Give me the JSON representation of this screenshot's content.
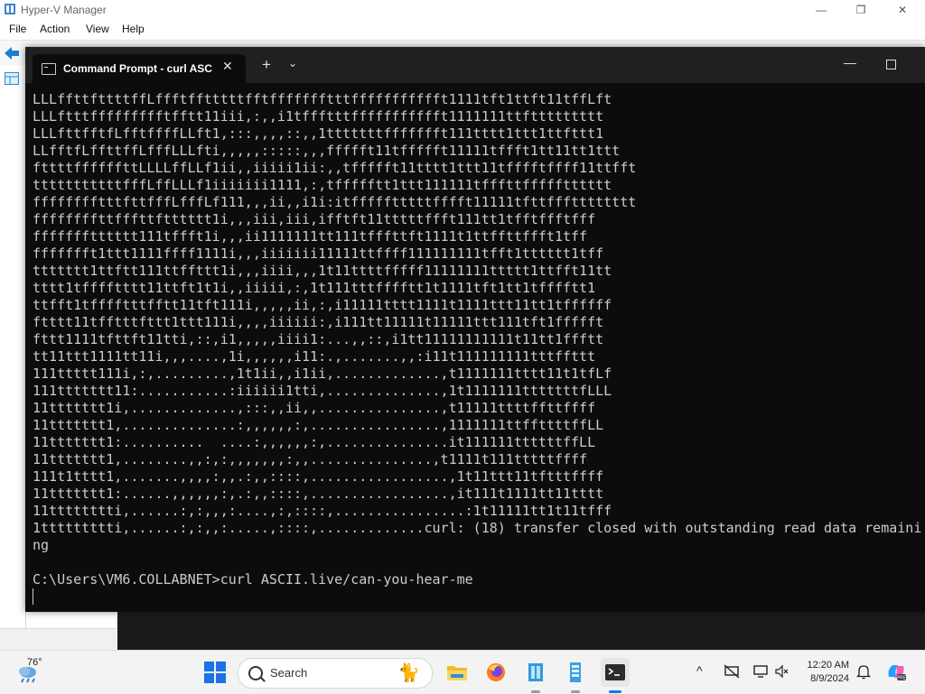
{
  "hyperv": {
    "title": "Hyper-V Manager",
    "menu": [
      "File",
      "Action",
      "View",
      "Help"
    ],
    "controls": {
      "minimize": "—",
      "restore": "❐",
      "close": "✕"
    }
  },
  "terminal": {
    "tab_title": "Command Prompt - curl  ASC",
    "tab_close": "✕",
    "new_tab": "+",
    "dropdown": "⌄",
    "minimize": "—",
    "lines": [
      "LLLffttfttttffLffftfftttttfftffffffftttffffffffffft1111tft1ttft11tffLft",
      "LLLftttffffffffftfftt11iii,:,,i1tffftttffffffffffft1111111ttfttttttttt",
      "LLLfttfftfLfftffffLLft1,:::,,,,::,,1tttttttffffffft111tttt1ttt1ttfttt1",
      "LLfftfLffttffLfffLLLfti,,,,,:::::,,,ffffft11tffffft11111tffft1tt11tt1ttt",
      "fttttffffffttLLLLffLLf1ii,,iiiii1ii:,,tffffft11tttt1ttt11tfffftffff11ttfft",
      "tttttttttttfffLffLLLf1iiiiiii1111,:,tffffftt1ttt111111tfffttffffftttttt",
      "fffffffftttfttfffLfffLf111,,,ii,,i1i:itffffftttttfffft11111tfttffftttttttt",
      "ffffffffttfffttftttttt1i,,,iii,iii,ifftft11tttttffft111tt1tfftffftfff",
      "ffffffftttttt111tffft1i,,,ii1111111tt111tfffttft1111t1ttffttffft1tff",
      "ffffffft1ttt1111ffff1111i,,,iiiiiii11111ttffff111111111tfft1tttttt1tff",
      "ttttttt1ttftt111ttffttt1i,,,iiii,,,1t11ttttfffff11111111ttttt1ttfft11tt",
      "tttt1tfffftttt11ttft1t1i,,iiiii,:,1t111tttfffftt1t1111tft1tt1tfffftt1",
      "ttfft1tfffftttfftt11tft111i,,,,,ii,:,i11111tttt1111t1111ttt11tt1tffffff",
      "ftttt11tfftttfttt1ttt111i,,,,iiiiii:,i111tt11111t11111ttt111tft1ffffft",
      "fttt1111tfttft11tti,::,i1,,,,,iiii1:...,,::,i1tt11111111111t11tt1ffftt",
      "tt11ttt1111tt11i,,,....,1i,,,,,,i11:.,.......,,:i11t111111111tttffttt",
      "111ttttt111i,:,.........,1t1ii,,i1ii,.............,t1111111tttt11t1tfLf",
      "111ttttttt11:...........:iiiiii1tti,..............,1t1111111tttttttfLLL",
      "11ttttttt1i,.............,:::,,ii,,...............,t11111ttttffttffff",
      "11ttttttt1,..............:,,,,,,:,................,1111111ttffttttffLL",
      "11ttttttt1:..........  ....:,,,,,,:,...............it111111ttttttffLL",
      "11ttttttt1,........,,:,:,,,,,,,:,,...............,t1111t111tttttffff",
      "111t1tttt1,.......,,,,:,,.:,,::::,.................,1t11ttt11tftttffff",
      "11ttttttt1:......,,,,,,:,.:,,::::,.................,it111t1111tt11tttt",
      "11tttttttti,......:,:,,,:....,:,::::,................:1t11111tt1t11tfff",
      "1ttttttttti,......:,:,,:.....,::::,.............curl: (18) transfer closed with outstanding read data remaini",
      "ng",
      "",
      "C:\\Users\\VM6.COLLABNET>curl ASCII.live/can-you-hear-me"
    ]
  },
  "taskbar": {
    "weather_temp": "76°",
    "search_placeholder": "Search",
    "clock_time": "12:20 AM",
    "clock_date": "8/9/2024",
    "tray": {
      "chevron": "^"
    }
  },
  "colors": {
    "terminal_bg": "#0c0c0c",
    "terminal_fg": "#cccccc",
    "tabbar_bg": "#202020",
    "accent": "#1a73e8"
  }
}
